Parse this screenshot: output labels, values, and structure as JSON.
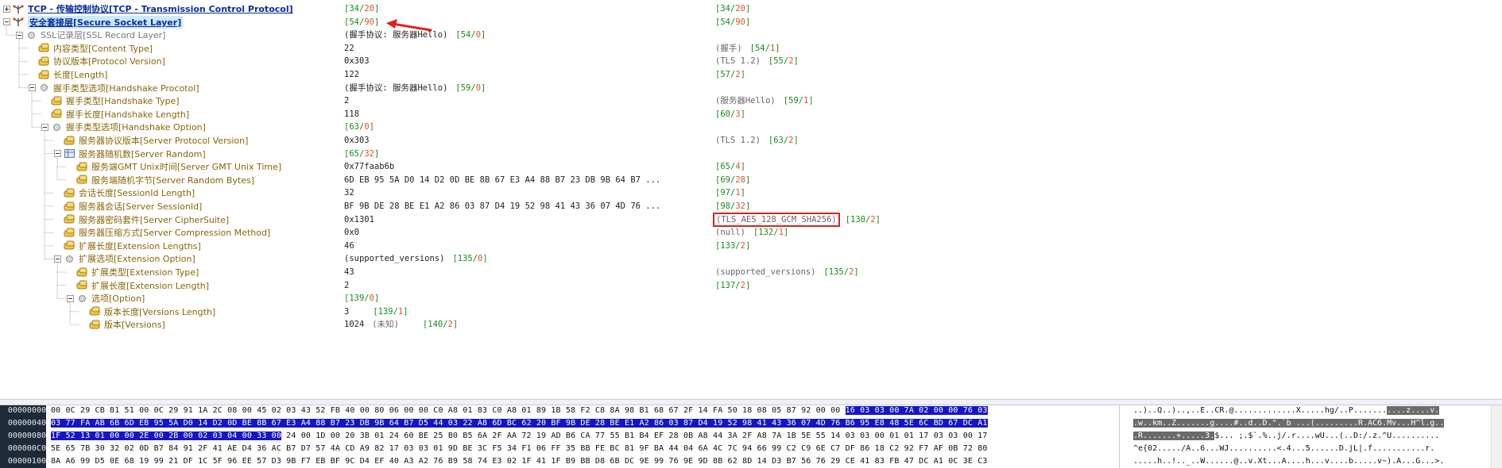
{
  "colors": {
    "label": "#8b6508",
    "top_label": "#0a2f9e",
    "field_pos": "#1a8a1a",
    "field_size": "#d9532c",
    "highlight_box": "#dd2020",
    "hex_select": "#1515c8"
  },
  "tree": [
    {
      "name": "TCP - 传输控制协议[TCP - Transmission Control Protocol]",
      "style": "top",
      "tog": "plus",
      "icon": "protocol-icon",
      "val": "",
      "fld": "34",
      "fsz": "20",
      "desc": ""
    },
    {
      "name": "安全套接层[Secure Socket Layer]",
      "style": "top sel",
      "tog": "minus",
      "icon": "protocol-icon",
      "val": "",
      "fld": "54",
      "fsz": "90",
      "desc": ""
    },
    {
      "name": "SSL记录层[SSL Record Layer]",
      "style": "gray",
      "tog": "minus",
      "icon": "dot-icon",
      "val": "(握手协议: 服务器Hello)",
      "fld": "54",
      "fsz": "0",
      "desc": "",
      "valfld": true
    },
    {
      "name": "内容类型[Content Type]",
      "style": "",
      "tog": "",
      "icon": "field-icon",
      "val": "22",
      "desc": "(握手)",
      "fld": "54",
      "fsz": "1"
    },
    {
      "name": "协议版本[Protocol Version]",
      "style": "",
      "tog": "",
      "icon": "field-icon",
      "val": "0x303",
      "desc": "(TLS 1.2)",
      "fld": "55",
      "fsz": "2"
    },
    {
      "name": "长度[Length]",
      "style": "",
      "tog": "",
      "icon": "field-icon",
      "val": "122",
      "desc": "",
      "fld": "57",
      "fsz": "2"
    },
    {
      "name": "握手类型选项[Handshake Procotol]",
      "style": "",
      "tog": "minus",
      "icon": "dot-icon",
      "val": "(握手协议: 服务器Hello)",
      "fld": "59",
      "fsz": "0",
      "desc": "",
      "valfld": true
    },
    {
      "name": "握手类型[Handshake Type]",
      "style": "",
      "tog": "",
      "icon": "field-icon",
      "val": "2",
      "desc": "(服务器Hello)",
      "fld": "59",
      "fsz": "1"
    },
    {
      "name": "握手长度[Handshake Length]",
      "style": "",
      "tog": "",
      "icon": "field-icon",
      "val": "118",
      "desc": "",
      "fld": "60",
      "fsz": "3"
    },
    {
      "name": "握手类型选项[Handshake Option]",
      "style": "",
      "tog": "minus",
      "icon": "dot-icon",
      "val": "",
      "fld": "63",
      "fsz": "0",
      "desc": "",
      "valfld": true
    },
    {
      "name": "服务器协议版本[Server Protocol Version]",
      "style": "",
      "tog": "",
      "icon": "field-icon",
      "val": "0x303",
      "desc": "(TLS 1.2)",
      "fld": "63",
      "fsz": "2"
    },
    {
      "name": "服务器随机数[Server Random]",
      "style": "",
      "tog": "minus",
      "icon": "grid-icon",
      "val": "",
      "fld": "65",
      "fsz": "32",
      "desc": "",
      "valfld": true
    },
    {
      "name": "服务端GMT Unix时间[Server GMT Unix Time]",
      "style": "",
      "tog": "",
      "icon": "field-icon",
      "val": "0x77faab6b",
      "desc": "",
      "fld": "65",
      "fsz": "4"
    },
    {
      "name": "服务端随机字节[Server Random Bytes]",
      "style": "",
      "tog": "",
      "icon": "field-icon",
      "val": "6D EB 95 5A D0 14 D2 0D BE 8B 67 E3 A4 88 B7 23 DB 9B 64 B7 ...",
      "desc": "",
      "fld": "69",
      "fsz": "28"
    },
    {
      "name": "会话长度[SessionId Length]",
      "style": "",
      "tog": "",
      "icon": "field-icon",
      "val": "32",
      "desc": "",
      "fld": "97",
      "fsz": "1"
    },
    {
      "name": "服务器会话[Server SessionId]",
      "style": "",
      "tog": "",
      "icon": "field-icon",
      "val": "BF 9B DE 28 BE E1 A2 86 03 87 D4 19 52 98 41 43 36 07 4D 76 ...",
      "desc": "",
      "fld": "98",
      "fsz": "32"
    },
    {
      "name": "服务器密码套件[Server CipherSuite]",
      "style": "",
      "tog": "",
      "icon": "field-icon",
      "val": "0x1301",
      "desc": "(TLS_AES_128_GCM_SHA256)",
      "fld": "130",
      "fsz": "2",
      "boxed": true
    },
    {
      "name": "服务器压缩方式[Server Compression Method]",
      "style": "",
      "tog": "",
      "icon": "field-icon",
      "val": "0x0",
      "desc": "(null)",
      "fld": "132",
      "fsz": "1"
    },
    {
      "name": "扩展长度[Extension Lengths]",
      "style": "",
      "tog": "",
      "icon": "field-icon",
      "val": "46",
      "desc": "",
      "fld": "133",
      "fsz": "2"
    },
    {
      "name": "扩展选项[Extension Option]",
      "style": "",
      "tog": "minus",
      "icon": "dot-icon",
      "val": "(supported_versions)",
      "fld": "135",
      "fsz": "0",
      "desc": "",
      "valfld": true
    },
    {
      "name": "扩展类型[Extension Type]",
      "style": "",
      "tog": "",
      "icon": "field-icon",
      "val": "43",
      "desc": "(supported_versions)",
      "fld": "135",
      "fsz": "2"
    },
    {
      "name": "扩展长度[Extension Length]",
      "style": "",
      "tog": "",
      "icon": "field-icon",
      "val": "2",
      "desc": "",
      "fld": "137",
      "fsz": "2"
    },
    {
      "name": "选项[Option]",
      "style": "",
      "tog": "minus",
      "icon": "dot-icon",
      "val": "",
      "fld": "139",
      "fsz": "0",
      "desc": "",
      "valfld": true
    },
    {
      "name": "版本长度[Versions Length]",
      "style": "",
      "tog": "",
      "icon": "field-icon",
      "val": "3",
      "fld": "139",
      "fsz": "1",
      "desc": "",
      "valfld": true,
      "valinline": true
    },
    {
      "name": "版本[Versions]",
      "style": "",
      "tog": "",
      "icon": "field-icon",
      "val": "1024",
      "desc2": "(未知)",
      "fld": "140",
      "fsz": "2",
      "desc": "",
      "valfld": true,
      "valinline": true
    }
  ],
  "hex": {
    "offsets": [
      "00000000",
      "00000040",
      "00000080",
      "000000C0",
      "00000100"
    ],
    "rows": [
      [
        {
          "t": "00 0C 29 CB 81 51 00 0C 29 91 1A 2C 08 00 45 02 03 43 52 FB 40 00 80 06 00 00 C0 A8 01 83 C0 A8 01 89 1B 58 F2 C8 8A 98 B1 68 67 2F 14 FA 50 18 08 05 87 92 00 00 ",
          "h": false
        },
        {
          "t": "16 03 03 00 7A 02 00 00 76 03",
          "h": true
        }
      ],
      [
        {
          "t": "03 77 FA AB 6B 6D EB 95 5A D0 14 D2 0D BE 8B 67 E3 A4 88 B7 23 DB 9B 64 B7 D5 44 03 22 A8 6D BC 62 20 BF 9B DE 28 BE E1 A2 86 03 87 D4 19 52 98 41 43 36 07 4D 76 B6 95 E8 48 5E 6C BD 67 DC A1",
          "h": true
        }
      ],
      [
        {
          "t": "1F 52 13 01 00 00 2E 00 2B 00 02 03 04 00 33 00",
          "h": true
        },
        {
          "t": " 24 00 1D 00 20 3B 01 24 60 BE 25 B0 B5 6A 2F AA 72 19 AD B6 CA 77 55 B1 B4 EF 28 0B A8 44 3A 2F A8 7A 1B 5E 55 14 03 03 00 01 01 17 03 03 00 17",
          "h": false
        }
      ],
      [
        {
          "t": "5E 65 7B 30 32 02 0D B7 84 91 2F 41 AE D4 36 AC B7 D7 57 4A CD A9 82 17 03 03 01 9D BE 3C F5 34 F1 06 FF 35 BB FE BC 81 9F BA 44 04 6A 4C 7C 94 66 99 C2 C9 6E C7 DF 86 18 C2 92 F7 AF 0B 72 80",
          "h": false
        }
      ],
      [
        {
          "t": "8A A6 99 D5 0E 68 19 99 21 DF 1C 5F 96 EE 57 D3 9B F7 EB BF 9C D4 EF 40 A3 A2 76 B9 58 74 E3 02 1F 41 1F B9 BB D8 6B DC 9E 99 76 9E 9D 8B 62 8D 14 D3 B7 56 76 29 CE 41 83 FB 47 DC A1 0C 3E C3",
          "h": false
        }
      ]
    ],
    "ascii": [
      [
        {
          "t": "..)..Q..)..,..E..CR.@.............X.....hg/..P.......",
          "h": false
        },
        {
          "t": "....z....v.",
          "h": true
        }
      ],
      [
        {
          "t": ".w..km..Z.......g....#..d..D.\".`b ...(.........R.AC6.Mv...H^l.g..",
          "h": true
        }
      ],
      [
        {
          "t": ".R.......+.....3.",
          "h": true
        },
        {
          "t": "$... ;.$`.%..j/.r....wU...(..D:/.z.^U..........",
          "h": false
        }
      ],
      [
        {
          "t": "^e{02...../A..6...WJ..........<.4...5......D.jL|.f...........r.",
          "h": false
        }
      ],
      [
        {
          "t": ".....h..!.._..W......@..v.Xt...A....h...v....b.....v~).A...G...>.",
          "h": false
        }
      ]
    ]
  }
}
